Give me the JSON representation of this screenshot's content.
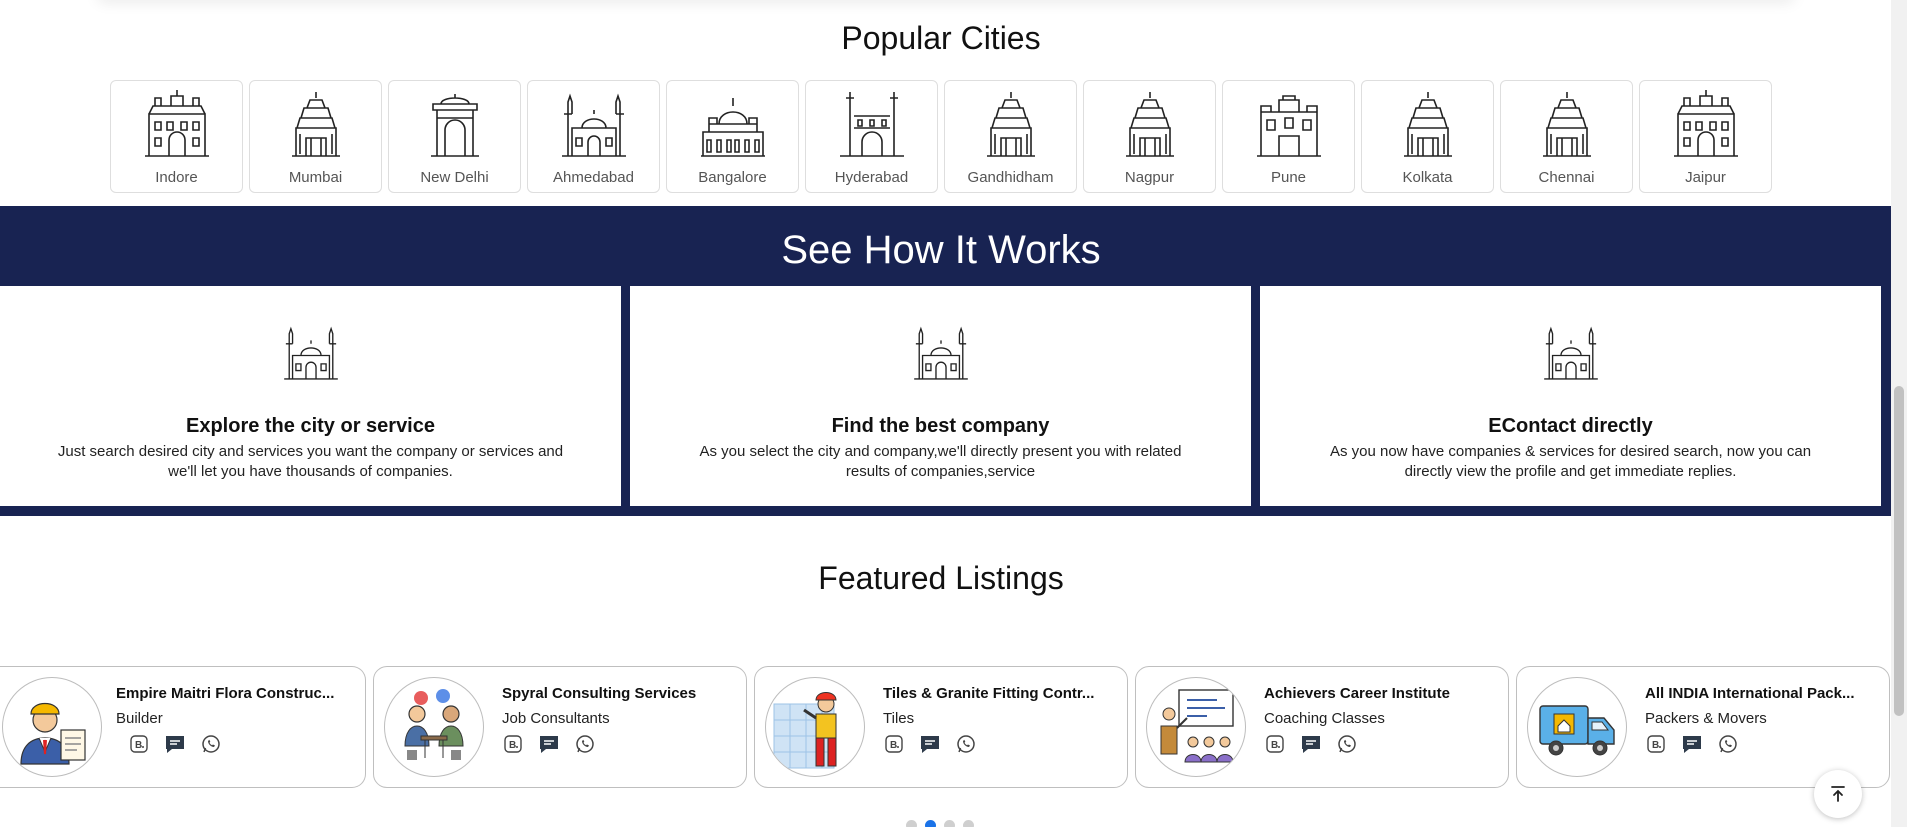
{
  "popular_cities": {
    "title": "Popular Cities",
    "cities": [
      {
        "label": "Indore",
        "icon": "palace-icon"
      },
      {
        "label": "Mumbai",
        "icon": "temple-icon"
      },
      {
        "label": "New Delhi",
        "icon": "india-gate-icon"
      },
      {
        "label": "Ahmedabad",
        "icon": "mosque-icon"
      },
      {
        "label": "Bangalore",
        "icon": "vidhana-soudha-icon"
      },
      {
        "label": "Hyderabad",
        "icon": "charminar-icon"
      },
      {
        "label": "Gandhidham",
        "icon": "temple-icon"
      },
      {
        "label": "Nagpur",
        "icon": "temple-icon"
      },
      {
        "label": "Pune",
        "icon": "fort-icon"
      },
      {
        "label": "Kolkata",
        "icon": "temple-icon"
      },
      {
        "label": "Chennai",
        "icon": "temple-icon"
      },
      {
        "label": "Jaipur",
        "icon": "palace-icon"
      }
    ]
  },
  "how_it_works": {
    "title": "See How It Works",
    "steps": [
      {
        "title": "Explore the city or service",
        "text": "Just search desired city and services you want the company or services and we'll let you have thousands of companies.",
        "icon": "mosque-icon"
      },
      {
        "title": "Find the best company",
        "text": "As you select the city and company,we'll directly present you with related results of companies,service",
        "icon": "mosque-icon"
      },
      {
        "title": "EContact directly",
        "text": "As you now have companies & services for desired search, now you can directly view the profile and get immediate replies.",
        "icon": "mosque-icon"
      }
    ]
  },
  "featured": {
    "title": "Featured Listings",
    "listings": [
      {
        "name": "Empire Maitri Flora Construc...",
        "category": "Builder",
        "avatar": "builder-avatar-icon"
      },
      {
        "name": "Spyral Consulting Services",
        "category": "Job Consultants",
        "avatar": "consulting-avatar-icon"
      },
      {
        "name": "Tiles & Granite Fitting Contr...",
        "category": "Tiles",
        "avatar": "tiles-worker-avatar-icon"
      },
      {
        "name": "Achievers Career Institute",
        "category": "Coaching Classes",
        "avatar": "coaching-avatar-icon"
      },
      {
        "name": "All INDIA International Pack...",
        "category": "Packers & Movers",
        "avatar": "truck-avatar-icon"
      }
    ],
    "action_icons": [
      "business-icon",
      "message-icon",
      "whatsapp-icon"
    ],
    "carousel": {
      "pages": 4,
      "active": 2
    }
  },
  "colors": {
    "navy": "#182352",
    "accent": "#1a73e8"
  }
}
